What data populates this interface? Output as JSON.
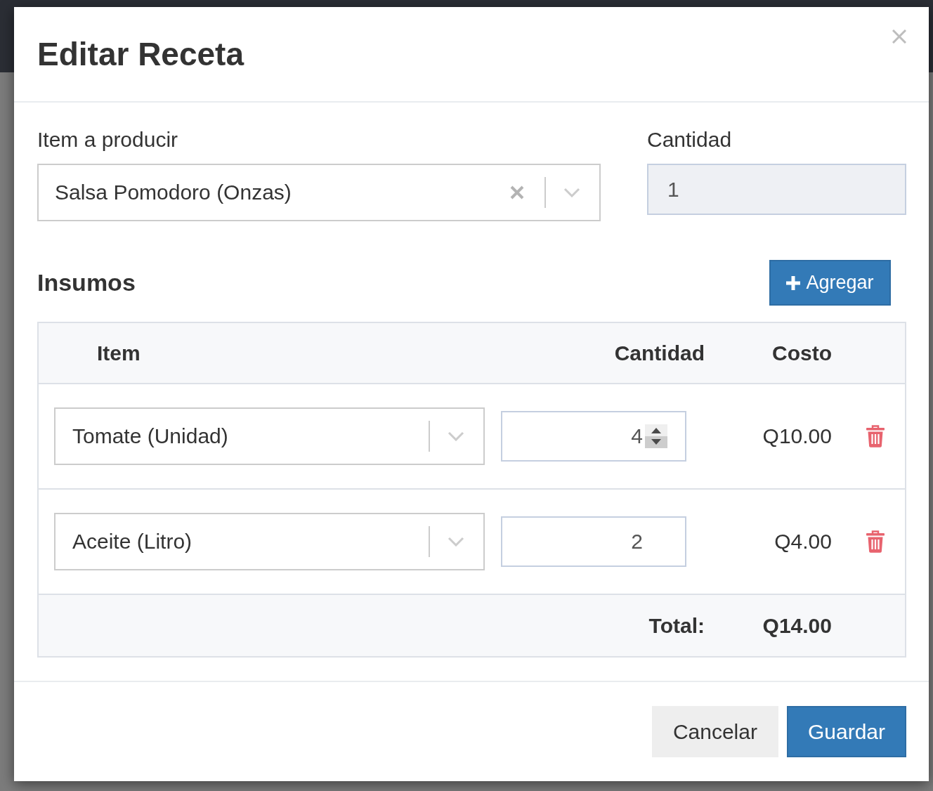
{
  "dialog": {
    "title": "Editar Receta"
  },
  "product": {
    "label": "Item a producir",
    "value": "Salsa Pomodoro (Onzas)",
    "clearable": true
  },
  "quantity": {
    "label": "Cantidad",
    "value": "1",
    "disabled": true
  },
  "supplies": {
    "heading": "Insumos",
    "add_button": "Agregar",
    "columns": [
      "Item",
      "Cantidad",
      "Costo"
    ],
    "rows": [
      {
        "item": "Tomate (Unidad)",
        "quantity": "4",
        "cost": "Q10.00",
        "focused": true
      },
      {
        "item": "Aceite (Litro)",
        "quantity": "2",
        "cost": "Q4.00",
        "focused": false
      }
    ],
    "total_label": "Total:",
    "total": "Q14.00"
  },
  "buttons": [
    {
      "label": "Cancelar",
      "kind": "secondary"
    },
    {
      "label": "Guardar",
      "kind": "primary"
    }
  ]
}
